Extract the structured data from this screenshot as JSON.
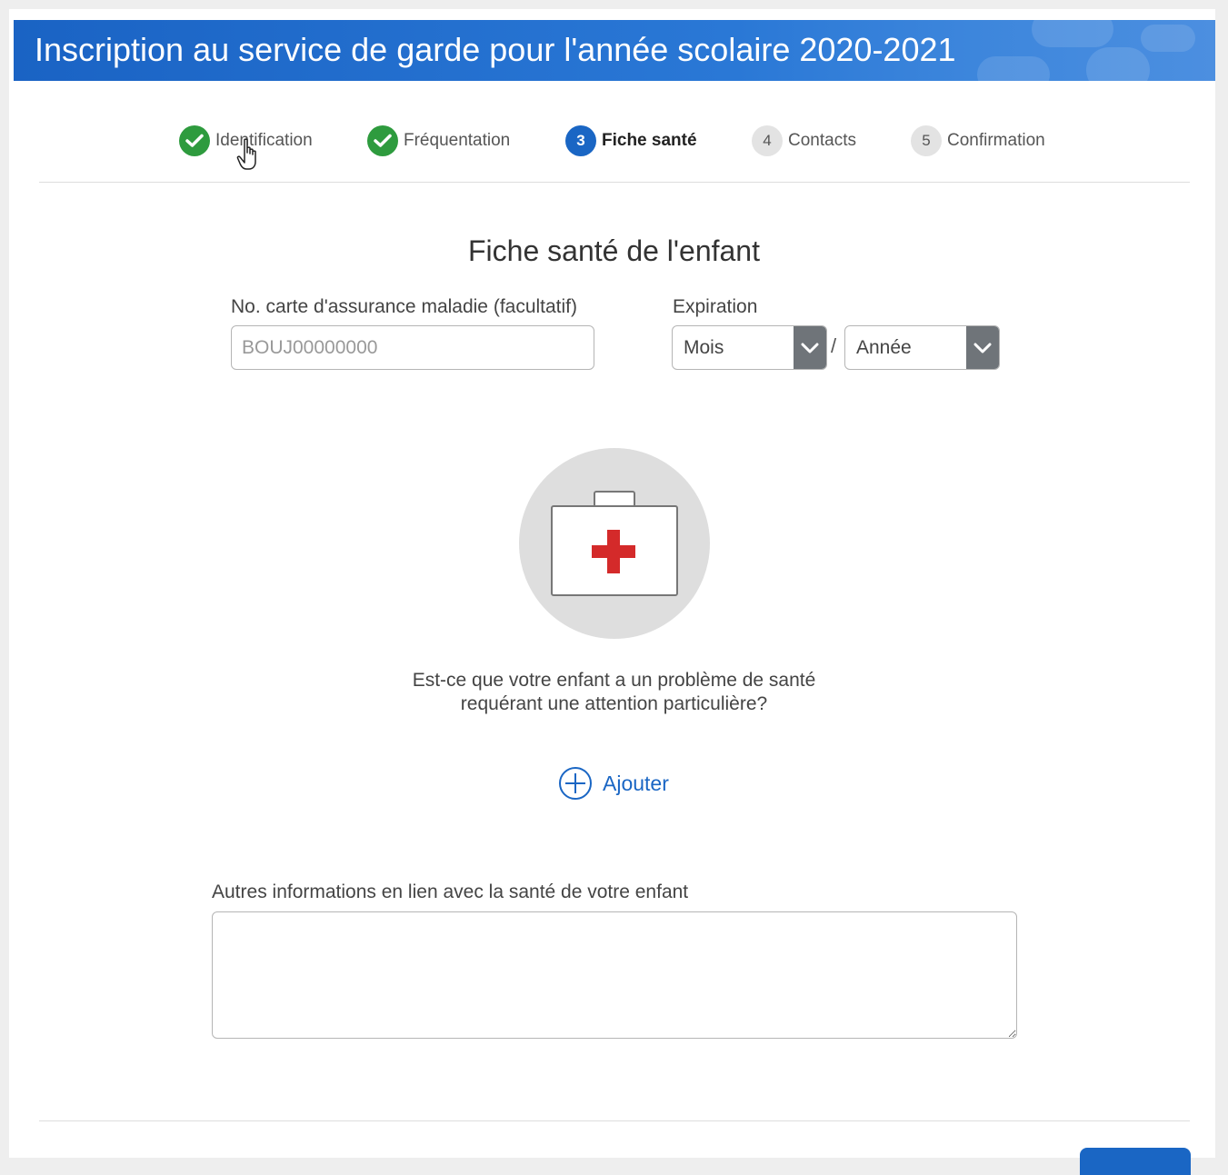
{
  "banner": {
    "title": "Inscription au service de garde pour l'année scolaire 2020-2021"
  },
  "steps": [
    {
      "number": "",
      "label": "Identification",
      "state": "done"
    },
    {
      "number": "",
      "label": "Fréquentation",
      "state": "done"
    },
    {
      "number": "3",
      "label": "Fiche santé",
      "state": "current"
    },
    {
      "number": "4",
      "label": "Contacts",
      "state": "todo"
    },
    {
      "number": "5",
      "label": "Confirmation",
      "state": "todo"
    }
  ],
  "form": {
    "title": "Fiche santé de l'enfant",
    "card_label": "No. carte d'assurance maladie (facultatif)",
    "card_placeholder": "BOUJ00000000",
    "card_value": "",
    "expiration_label": "Expiration",
    "month_select": "Mois",
    "separator": "/",
    "year_select": "Année",
    "question_line1": "Est-ce que votre enfant a un problème de santé",
    "question_line2": "requérant une attention particulière?",
    "add_label": "Ajouter",
    "other_info_label": "Autres informations en lien avec la santé de votre enfant",
    "other_info_value": ""
  },
  "colors": {
    "primary": "#1a66c4",
    "done": "#2e9b3e",
    "select_arrow_bg": "#6f7479",
    "cross_red": "#d42a2a"
  },
  "icons": {
    "done_step": "check-circle-icon",
    "select_arrow": "chevron-down-icon",
    "add": "plus-circle-icon",
    "illustration": "first-aid-kit-icon"
  }
}
